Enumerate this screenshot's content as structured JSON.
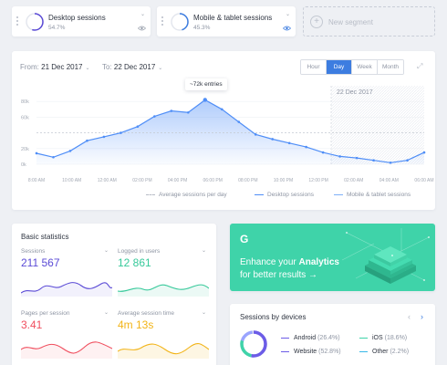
{
  "segments": [
    {
      "title": "Desktop sessions",
      "percent": "54.7%"
    },
    {
      "title": "Mobile & tablet sessions",
      "percent": "45.3%"
    }
  ],
  "new_segment_label": "New segment",
  "date_range": {
    "from_label": "From:",
    "from_value": "21 Dec 2017",
    "to_label": "To:",
    "to_value": "22 Dec 2017"
  },
  "period_tabs": [
    "Hour",
    "Day",
    "Week",
    "Month"
  ],
  "active_tab": "Day",
  "tooltip": "~72k entries",
  "highlight_date": "22 Dec 2017",
  "chart_data": {
    "type": "area",
    "y_ticks": [
      "80k",
      "60k",
      "20k",
      "0k"
    ],
    "x_ticks": [
      "8:00 AM",
      "10:00 AM",
      "12:00 AM",
      "02:00 PM",
      "04:00 PM",
      "06:00 PM",
      "08:00 PM",
      "10:00 PM",
      "12:00 PM",
      "02:00 AM",
      "04:00 AM",
      "06:00 AM"
    ],
    "series": [
      {
        "name": "Desktop sessions",
        "color": "#4f8ef7",
        "values": [
          14,
          9,
          17,
          30,
          35,
          40,
          48,
          61,
          68,
          66,
          82,
          70,
          54,
          38,
          32,
          27,
          22,
          15,
          10,
          8,
          5,
          2,
          5,
          15
        ]
      }
    ],
    "average_line": 40,
    "legend": [
      "Average sessions per day",
      "Desktop sessions",
      "Mobile & tablet sessions"
    ]
  },
  "basic_statistics": {
    "title": "Basic statistics",
    "items": [
      {
        "label": "Sessions",
        "value": "211 567",
        "color": "#5b4bd6"
      },
      {
        "label": "Logged in users",
        "value": "12 861",
        "color": "#36c99a"
      },
      {
        "label": "Pages per session",
        "value": "3.41",
        "color": "#f04e5e"
      },
      {
        "label": "Average session time",
        "value": "4m 13s",
        "color": "#f2b418"
      }
    ]
  },
  "promo": {
    "logo": "G",
    "line1_prefix": "Enhance your ",
    "line1_bold": "Analytics",
    "line2": "for better results →"
  },
  "devices": {
    "title": "Sessions by devices",
    "items": [
      {
        "name": "Android",
        "pct": "(26.4%)",
        "color": "#6c5ce7"
      },
      {
        "name": "iOS",
        "pct": "(18.6%)",
        "color": "#3fd3a9"
      },
      {
        "name": "Website",
        "pct": "(52.8%)",
        "color": "#6c5ce7"
      },
      {
        "name": "Other",
        "pct": "(2.2%)",
        "color": "#38b8e8"
      }
    ]
  }
}
